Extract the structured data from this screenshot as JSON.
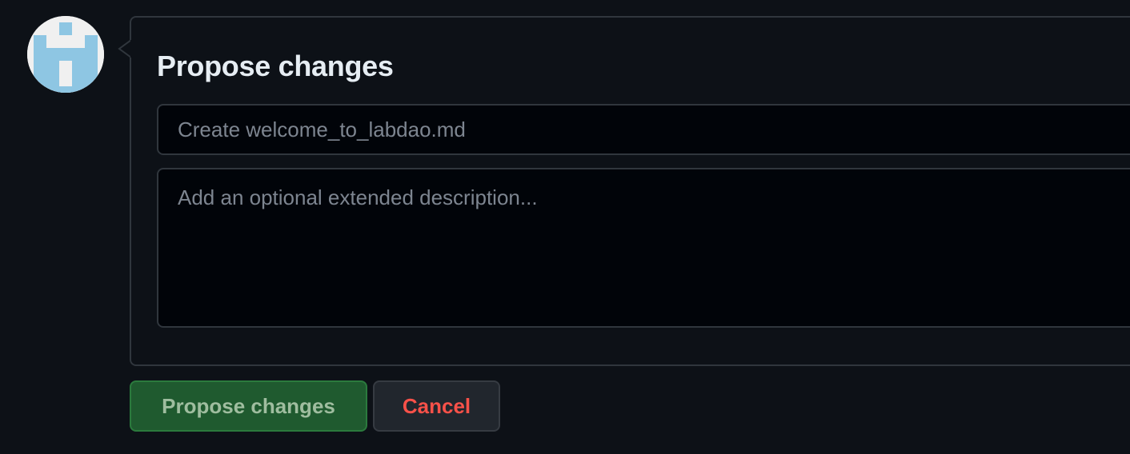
{
  "commit_form": {
    "title": "Propose changes",
    "summary_placeholder": "Create welcome_to_labdao.md",
    "summary_value": "",
    "description_placeholder": "Add an optional extended description...",
    "description_value": ""
  },
  "actions": {
    "propose_label": "Propose changes",
    "cancel_label": "Cancel"
  },
  "avatar": {
    "icon": "identicon",
    "colors": [
      "#8ec6e3",
      "#f0f0f0"
    ]
  },
  "colors": {
    "background": "#0d1117",
    "border": "#30363d",
    "primary_button": "#1f5a2f",
    "danger_text": "#f85149"
  }
}
